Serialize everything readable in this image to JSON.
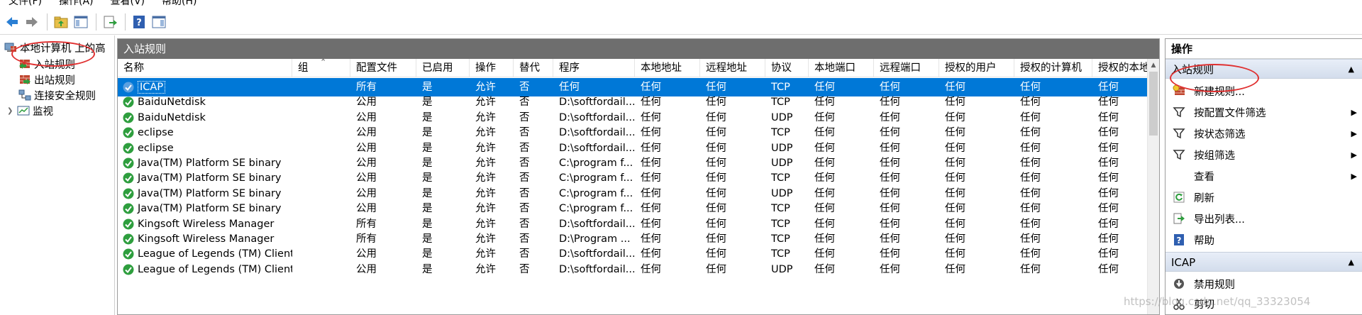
{
  "menu": [
    "文件(F)",
    "操作(A)",
    "查看(V)",
    "帮助(H)"
  ],
  "toolbar_icons": [
    "back-arrow-icon",
    "forward-arrow-icon",
    "folder-up-icon",
    "show-hide-tree-icon",
    "export-icon",
    "help-icon",
    "show-hide-action-pane-icon"
  ],
  "tree": {
    "root": "本地计算机 上的高",
    "items": [
      "入站规则",
      "出站规则",
      "连接安全规则",
      "监视"
    ]
  },
  "center": {
    "title": "入站规则",
    "columns": [
      "名称",
      "组",
      "配置文件",
      "已启用",
      "操作",
      "替代",
      "程序",
      "本地地址",
      "远程地址",
      "协议",
      "本地端口",
      "远程端口",
      "授权的用户",
      "授权的计算机",
      "授权的本地"
    ],
    "rows": [
      [
        "ICAP",
        "",
        "所有",
        "是",
        "允许",
        "否",
        "任何",
        "任何",
        "任何",
        "TCP",
        "任何",
        "任何",
        "任何",
        "任何",
        "任何"
      ],
      [
        "BaiduNetdisk",
        "",
        "公用",
        "是",
        "允许",
        "否",
        "D:\\softfordail...",
        "任何",
        "任何",
        "TCP",
        "任何",
        "任何",
        "任何",
        "任何",
        "任何"
      ],
      [
        "BaiduNetdisk",
        "",
        "公用",
        "是",
        "允许",
        "否",
        "D:\\softfordail...",
        "任何",
        "任何",
        "UDP",
        "任何",
        "任何",
        "任何",
        "任何",
        "任何"
      ],
      [
        "eclipse",
        "",
        "公用",
        "是",
        "允许",
        "否",
        "D:\\softfordail...",
        "任何",
        "任何",
        "TCP",
        "任何",
        "任何",
        "任何",
        "任何",
        "任何"
      ],
      [
        "eclipse",
        "",
        "公用",
        "是",
        "允许",
        "否",
        "D:\\softfordail...",
        "任何",
        "任何",
        "UDP",
        "任何",
        "任何",
        "任何",
        "任何",
        "任何"
      ],
      [
        "Java(TM) Platform SE binary",
        "",
        "公用",
        "是",
        "允许",
        "否",
        "C:\\program f...",
        "任何",
        "任何",
        "UDP",
        "任何",
        "任何",
        "任何",
        "任何",
        "任何"
      ],
      [
        "Java(TM) Platform SE binary",
        "",
        "公用",
        "是",
        "允许",
        "否",
        "C:\\program f...",
        "任何",
        "任何",
        "TCP",
        "任何",
        "任何",
        "任何",
        "任何",
        "任何"
      ],
      [
        "Java(TM) Platform SE binary",
        "",
        "公用",
        "是",
        "允许",
        "否",
        "C:\\program f...",
        "任何",
        "任何",
        "UDP",
        "任何",
        "任何",
        "任何",
        "任何",
        "任何"
      ],
      [
        "Java(TM) Platform SE binary",
        "",
        "公用",
        "是",
        "允许",
        "否",
        "C:\\program f...",
        "任何",
        "任何",
        "TCP",
        "任何",
        "任何",
        "任何",
        "任何",
        "任何"
      ],
      [
        "Kingsoft Wireless Manager",
        "",
        "所有",
        "是",
        "允许",
        "否",
        "D:\\softfordail...",
        "任何",
        "任何",
        "TCP",
        "任何",
        "任何",
        "任何",
        "任何",
        "任何"
      ],
      [
        "Kingsoft Wireless Manager",
        "",
        "所有",
        "是",
        "允许",
        "否",
        "D:\\Program ...",
        "任何",
        "任何",
        "TCP",
        "任何",
        "任何",
        "任何",
        "任何",
        "任何"
      ],
      [
        "League of Legends (TM) Client",
        "",
        "公用",
        "是",
        "允许",
        "否",
        "D:\\softfordail...",
        "任何",
        "任何",
        "TCP",
        "任何",
        "任何",
        "任何",
        "任何",
        "任何"
      ],
      [
        "League of Legends (TM) Client",
        "",
        "公用",
        "是",
        "允许",
        "否",
        "D:\\softfordail...",
        "任何",
        "任何",
        "UDP",
        "任何",
        "任何",
        "任何",
        "任何",
        "任何"
      ]
    ]
  },
  "actions": {
    "title": "操作",
    "section1": "入站规则",
    "items1": [
      "新建规则...",
      "按配置文件筛选",
      "按状态筛选",
      "按组筛选",
      "查看",
      "刷新",
      "导出列表...",
      "帮助"
    ],
    "section2": "ICAP",
    "items2": [
      "禁用规则",
      "剪切"
    ]
  },
  "watermark": "https://blog.csdn.net/qq_33323054",
  "colors": {
    "selection": "#0078d7",
    "annotation": "#e03030",
    "rule-enabled": "#2e9e3e"
  }
}
